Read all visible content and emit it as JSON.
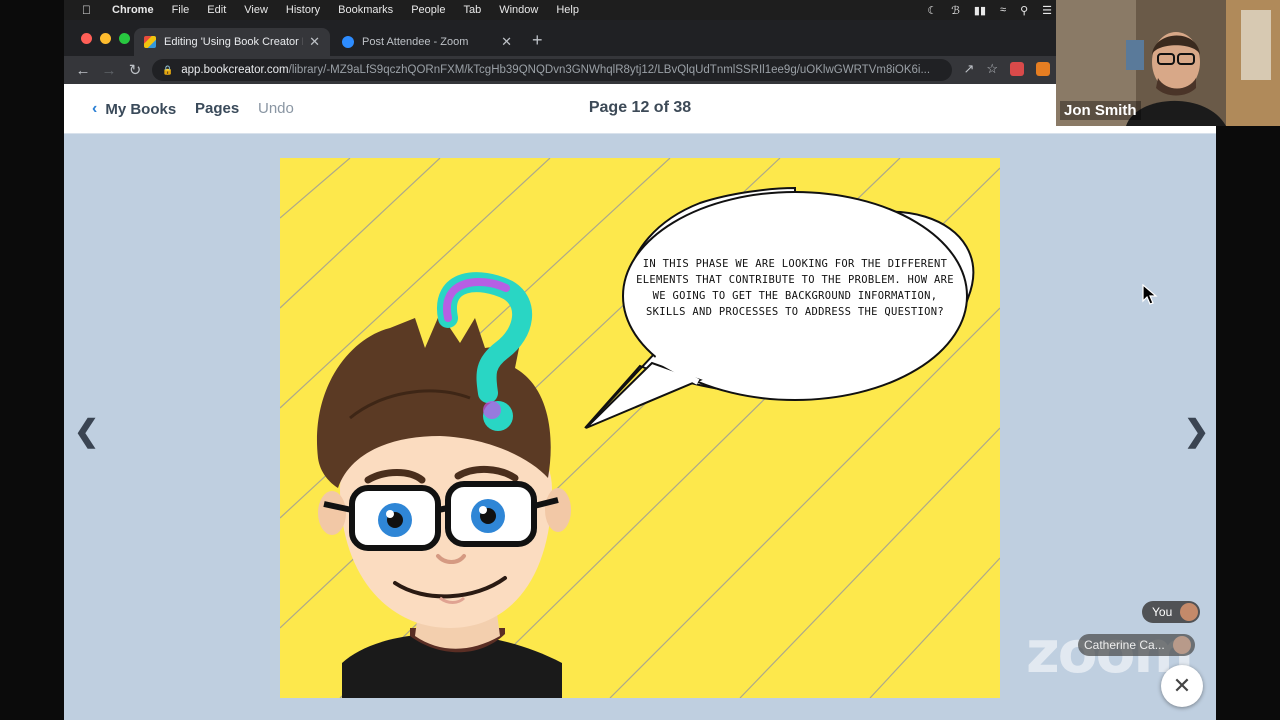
{
  "menubar": {
    "app": "Chrome",
    "items": [
      "File",
      "Edit",
      "View",
      "History",
      "Bookmarks",
      "People",
      "Tab",
      "Window",
      "Help"
    ]
  },
  "browser": {
    "tabs": [
      {
        "label": "Editing 'Using Book Creator In",
        "favicon_color": "#e74c3c"
      },
      {
        "label": "Post Attendee - Zoom",
        "favicon_color": "#2d8cff"
      }
    ],
    "url_host": "app.bookcreator.com",
    "url_path": "/library/-MZ9aLfS9qczhQORnFXM/kTcgHb39QNQDvn3GNWhqlR8ytj12/LBvQlqUdTnmlSSRIl1ee9g/uOKlwGWRTVm8iOK6i..."
  },
  "bookcreator": {
    "back_label": "My Books",
    "pages_label": "Pages",
    "undo_label": "Undo",
    "page_indicator": "Page 12 of 38"
  },
  "comic": {
    "bubble_text": "In this phase we are looking for the different elements that contribute to the problem. How are we going to get the background information, skills and processes to address the question?",
    "background_color": "#fde84c"
  },
  "zoom": {
    "participant_name": "Jon Smith",
    "self_label": "You",
    "other_participant": "Catherine Ca...",
    "logo_text": "zoom"
  }
}
